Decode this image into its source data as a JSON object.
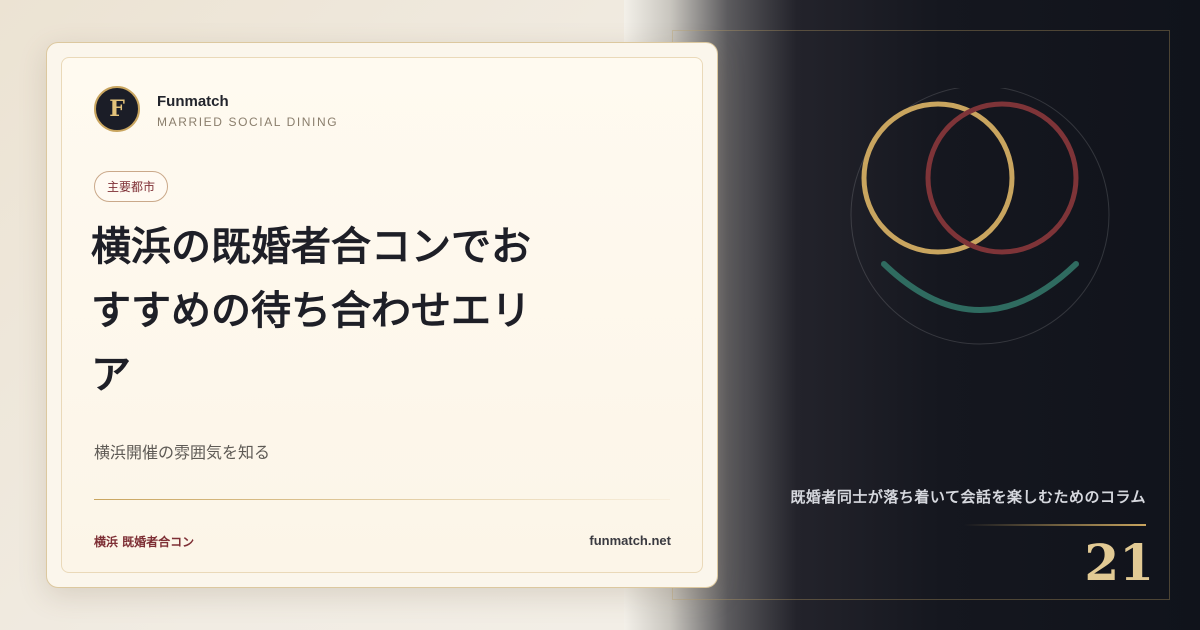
{
  "brand": {
    "logo_letter": "F",
    "name": "Funmatch",
    "tagline": "MARRIED SOCIAL DINING"
  },
  "category": "主要都市",
  "headline": "横浜の既婚者合コンでおすすめの待ち合わせエリア",
  "subtitle": "横浜開催の雰囲気を知る",
  "footer": {
    "tag": "横浜 既婚者合コン",
    "site": "funmatch.net"
  },
  "right_panel": {
    "tagline": "既婚者同士が落ち着いて会話を楽しむためのコラム",
    "issue_number": "21"
  },
  "colors": {
    "gold": "#c9a55f",
    "burgundy": "#7e3438",
    "teal": "#2f6b60",
    "dark_navy": "#10131b",
    "cream": "#fbf6ec"
  },
  "icons": {
    "emblem": "two-rings-smile-icon"
  }
}
